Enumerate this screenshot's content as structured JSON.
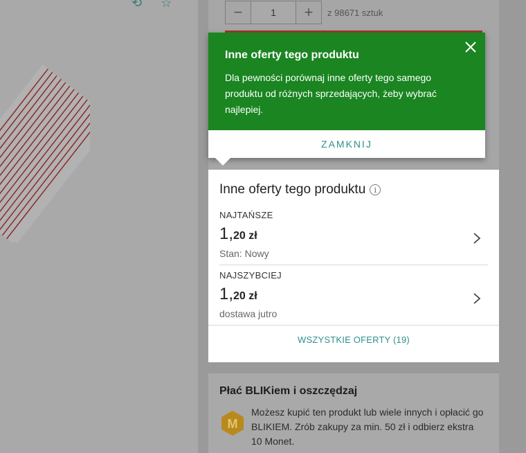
{
  "quantity": {
    "minus_symbol": "−",
    "value": "1",
    "plus_symbol": "+",
    "stock_text": "z 98671 sztuk"
  },
  "tooltip": {
    "title": "Inne oferty tego produktu",
    "text": "Dla pewności porównaj inne oferty tego samego produktu od różnych sprzedających, żeby wybrać najlepiej.",
    "close_label": "ZAMKNIJ",
    "background_color": "#1a8521"
  },
  "offers": {
    "title": "Inne oferty tego produktu",
    "info_symbol": "i",
    "items": [
      {
        "label": "NAJTAŃSZE",
        "price_main": "1,",
        "price_rest": "20 zł",
        "sub": "Stan: Nowy"
      },
      {
        "label": "NAJSZYBCIEJ",
        "price_main": "1,",
        "price_rest": "20 zł",
        "sub": "dostawa jutro"
      }
    ],
    "all_offers_label": "WSZYSTKIE OFERTY (19)",
    "link_color": "#2f8f8a"
  },
  "blik": {
    "title": "Płać BLIKiem i oszczędzaj",
    "text": "Możesz kupić ten produkt lub wiele innych i opłacić go BLIKIEM. Zrób zakupy za min. 50 zł i odbierz ekstra 10 Monet.",
    "badge_icon": "coin-m-icon"
  }
}
